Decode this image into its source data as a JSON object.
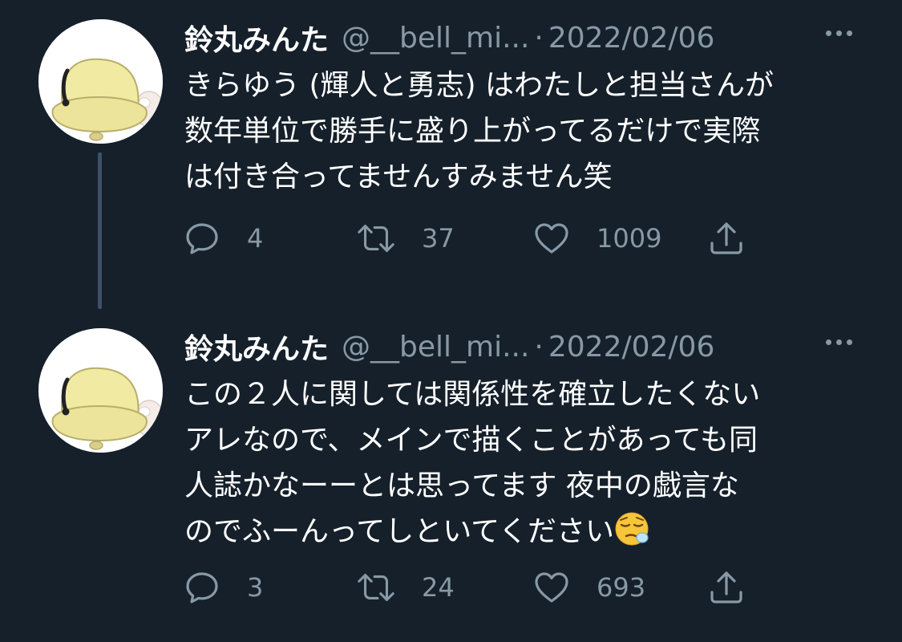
{
  "colors": {
    "background": "#15202b",
    "text_primary": "#ffffff",
    "text_secondary": "#8899a6",
    "thread_line": "#3d5166",
    "avatar_bell": "#f1eaa3"
  },
  "icons": {
    "more": "more-horizontal-icon",
    "reply": "reply-icon",
    "retweet": "retweet-icon",
    "like": "heart-icon",
    "share": "share-icon",
    "emoji": "sleepy-face-emoji"
  },
  "tweets": [
    {
      "display_name": "鈴丸みんた",
      "handle": "@__bell_mi...",
      "separator": "·",
      "date": "2022/02/06",
      "text_lines": [
        "きらゆう (輝人と勇志) はわたしと担当さんが",
        "数年単位で勝手に盛り上がってるだけで実際",
        "は付き合ってませんすみません笑"
      ],
      "replies": "4",
      "retweets": "37",
      "likes": "1009"
    },
    {
      "display_name": "鈴丸みんた",
      "handle": "@__bell_mi...",
      "separator": "·",
      "date": "2022/02/06",
      "text_lines": [
        "この２人に関しては関係性を確立したくない",
        "アレなので、メインで描くことがあっても同",
        "人誌かなーーとは思ってます  夜中の戯言な",
        "のでふーんってしといてください"
      ],
      "replies": "3",
      "retweets": "24",
      "likes": "693"
    }
  ]
}
